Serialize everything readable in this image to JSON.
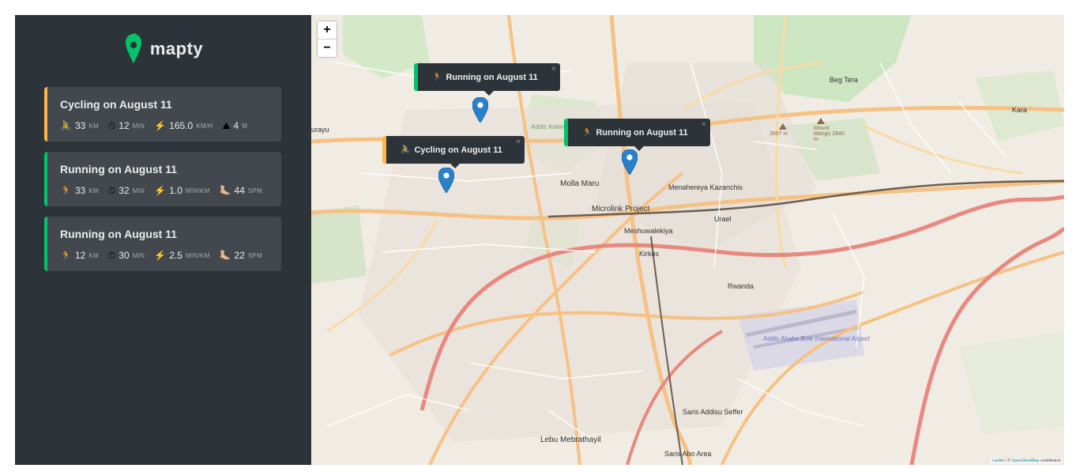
{
  "logo": {
    "text": "mapty",
    "icon": "map-pin-icon",
    "color": "#00c46a"
  },
  "workouts": [
    {
      "type": "cycling",
      "title": "Cycling on August 11",
      "accent": "#ffb545",
      "stats": [
        {
          "icon": "🚴",
          "value": "33",
          "unit": "KM"
        },
        {
          "icon": "⏱",
          "value": "12",
          "unit": "MIN"
        },
        {
          "icon": "⚡️",
          "value": "165.0",
          "unit": "KM/H"
        },
        {
          "icon": "⛰",
          "value": "4",
          "unit": "M"
        }
      ]
    },
    {
      "type": "running",
      "title": "Running on August 11",
      "accent": "#00c46a",
      "stats": [
        {
          "icon": "🏃",
          "value": "33",
          "unit": "KM"
        },
        {
          "icon": "⏱",
          "value": "32",
          "unit": "MIN"
        },
        {
          "icon": "⚡️",
          "value": "1.0",
          "unit": "MIN/KM"
        },
        {
          "icon": "🦶🏼",
          "value": "44",
          "unit": "SPM"
        }
      ]
    },
    {
      "type": "running",
      "title": "Running on August 11",
      "accent": "#00c46a",
      "stats": [
        {
          "icon": "🏃",
          "value": "12",
          "unit": "KM"
        },
        {
          "icon": "⏱",
          "value": "30",
          "unit": "MIN"
        },
        {
          "icon": "⚡️",
          "value": "2.5",
          "unit": "MIN/KM"
        },
        {
          "icon": "🦶🏼",
          "value": "22",
          "unit": "SPM"
        }
      ]
    }
  ],
  "map": {
    "zoom_in": "+",
    "zoom_out": "−",
    "popups": [
      {
        "type": "running",
        "icon": "🏃",
        "label": "Running on August 11",
        "close": "×"
      },
      {
        "type": "running",
        "icon": "🏃",
        "label": "Running on August 11",
        "close": "×"
      },
      {
        "type": "cycling",
        "icon": "🚴",
        "label": "Cycling on August 11",
        "close": "×"
      }
    ],
    "attribution": {
      "leaflet": "Leaflet",
      "sep": " | © ",
      "osm": "OpenStreetMap",
      "suffix": " contributors"
    },
    "labels": [
      "Beg Tera",
      "Molla Maru",
      "Menahereya Kazanchis",
      "Microlink Project",
      "Urael",
      "Meshuwalekiya",
      "Kirkos",
      "Rwanda",
      "Lebu Mebrathayil",
      "Saris Addisu Seffer",
      "Saris Abo Area",
      "Addis Ababa Bole International Airport",
      "Kara",
      "urayu",
      "2697 m",
      "Mount Mango 2640 m",
      "Addis Ketema"
    ]
  }
}
